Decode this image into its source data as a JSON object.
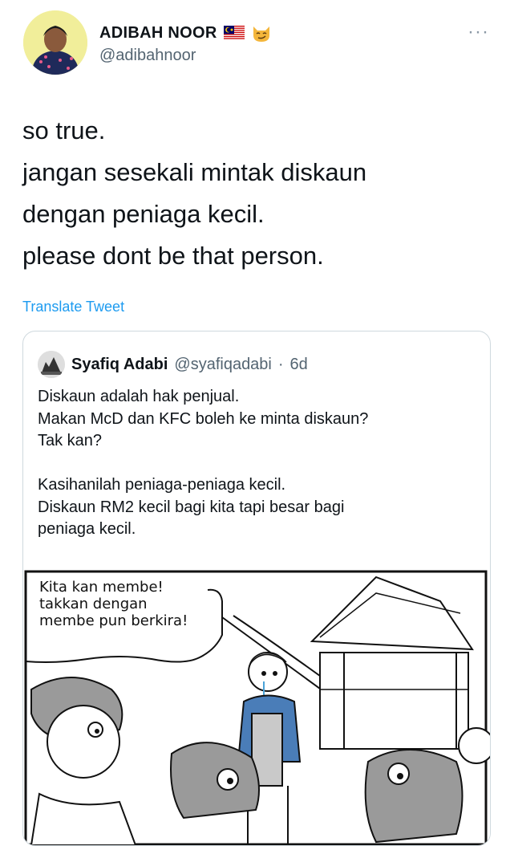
{
  "tweet": {
    "author_name": "ADIBAH NOOR",
    "author_handle": "@adibahnoor",
    "text_lines": [
      "so true.",
      "jangan sesekali mintak diskaun",
      "dengan peniaga kecil.",
      "please dont be that person."
    ],
    "translate_label": "Translate Tweet",
    "more_label": "···"
  },
  "quote": {
    "author_name": "Syafiq Adabi",
    "author_handle": "@syafiqadabi",
    "separator": "·",
    "time": "6d",
    "text_lines": [
      "Diskaun adalah hak penjual.",
      "Makan McD dan KFC boleh ke minta diskaun?",
      "Tak kan?",
      "",
      "Kasihanilah peniaga-peniaga kecil.",
      "Diskaun RM2 kecil bagi kita tapi besar bagi",
      "peniaga kecil."
    ],
    "comic": {
      "speech_lines": [
        "Kita kan membe!",
        "takkan dengan",
        "membe pun berkira!"
      ]
    }
  },
  "icons": {
    "flag": "malaysia-flag-icon",
    "emoji": "smirking-cat-icon",
    "more": "more-options-icon"
  },
  "colors": {
    "link": "#1d9bf0",
    "secondary_text": "#536471",
    "border": "#cfd9de"
  }
}
